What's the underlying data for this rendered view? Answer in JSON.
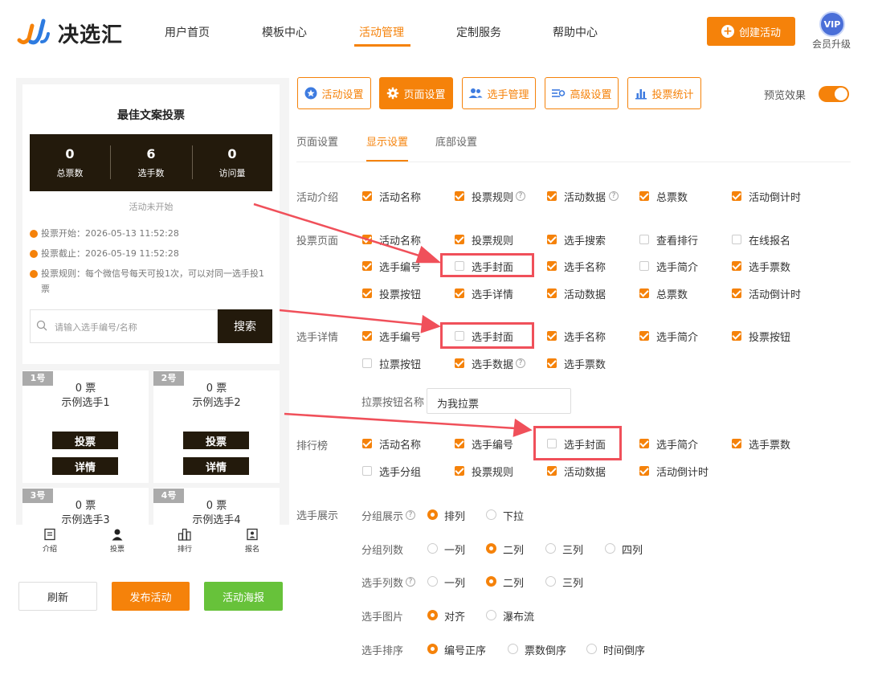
{
  "header": {
    "logo_text": "决选汇",
    "nav": [
      "用户首页",
      "模板中心",
      "活动管理",
      "定制服务",
      "帮助中心"
    ],
    "create_button": "创建活动",
    "vip_badge": "VIP",
    "vip_label": "会员升级",
    "accent_color": "#f5820a"
  },
  "preview": {
    "title": "最佳文案投票",
    "stats": [
      {
        "value": "0",
        "label": "总票数"
      },
      {
        "value": "6",
        "label": "选手数"
      },
      {
        "value": "0",
        "label": "访问量"
      }
    ],
    "status": "活动未开始",
    "info": [
      "投票开始：2026-05-13 11:52:28",
      "投票截止：2026-05-19 11:52:28",
      "投票规则：每个微信号每天可投1次，可以对同一选手投1票"
    ],
    "search_placeholder": "请输入选手编号/名称",
    "search_button": "搜索",
    "candidates": [
      {
        "tag": "1号",
        "votes": "0 票",
        "name": "示例选手1",
        "vote_btn": "投票",
        "detail_btn": "详情"
      },
      {
        "tag": "2号",
        "votes": "0 票",
        "name": "示例选手2",
        "vote_btn": "投票",
        "detail_btn": "详情"
      },
      {
        "tag": "3号",
        "votes": "0 票",
        "name": "示例选手3"
      },
      {
        "tag": "4号",
        "votes": "0 票",
        "name": "示例选手4"
      }
    ],
    "bottom_tabs": [
      "介绍",
      "投票",
      "排行",
      "报名"
    ]
  },
  "actions": {
    "refresh": "刷新",
    "publish": "发布活动",
    "poster": "活动海报"
  },
  "top_buttons": [
    "活动设置",
    "页面设置",
    "选手管理",
    "高级设置",
    "投票统计"
  ],
  "preview_toggle_label": "预览效果",
  "subtabs": [
    "页面设置",
    "显示设置",
    "底部设置"
  ],
  "sections": {
    "intro": {
      "label": "活动介绍",
      "items": [
        {
          "label": "活动名称",
          "checked": true
        },
        {
          "label": "投票规则",
          "checked": true
        },
        {
          "label": "活动数据",
          "checked": true
        },
        {
          "label": "总票数",
          "checked": true
        },
        {
          "label": "活动倒计时",
          "checked": true
        }
      ]
    },
    "vote_page": {
      "label": "投票页面",
      "rows": [
        [
          {
            "label": "活动名称",
            "checked": true
          },
          {
            "label": "投票规则",
            "checked": true
          },
          {
            "label": "选手搜索",
            "checked": true
          },
          {
            "label": "查看排行",
            "checked": false
          },
          {
            "label": "在线报名",
            "checked": false
          }
        ],
        [
          {
            "label": "选手编号",
            "checked": true
          },
          {
            "label": "选手封面",
            "checked": false
          },
          {
            "label": "选手名称",
            "checked": true
          },
          {
            "label": "选手简介",
            "checked": false
          },
          {
            "label": "选手票数",
            "checked": true
          }
        ],
        [
          {
            "label": "投票按钮",
            "checked": true
          },
          {
            "label": "选手详情",
            "checked": true
          },
          {
            "label": "活动数据",
            "checked": true
          },
          {
            "label": "总票数",
            "checked": true
          },
          {
            "label": "活动倒计时",
            "checked": true
          }
        ]
      ]
    },
    "detail": {
      "label": "选手详情",
      "rows": [
        [
          {
            "label": "选手编号",
            "checked": true
          },
          {
            "label": "选手封面",
            "checked": false
          },
          {
            "label": "选手名称",
            "checked": true
          },
          {
            "label": "选手简介",
            "checked": true
          },
          {
            "label": "投票按钮",
            "checked": true
          }
        ],
        [
          {
            "label": "拉票按钮",
            "checked": false
          },
          {
            "label": "选手数据",
            "checked": true
          },
          {
            "label": "选手票数",
            "checked": true
          }
        ]
      ],
      "pull_label": "拉票按钮名称",
      "pull_value": "为我拉票"
    },
    "ranking": {
      "label": "排行榜",
      "rows": [
        [
          {
            "label": "活动名称",
            "checked": true
          },
          {
            "label": "选手编号",
            "checked": true
          },
          {
            "label": "选手封面",
            "checked": false
          },
          {
            "label": "选手简介",
            "checked": true
          },
          {
            "label": "选手票数",
            "checked": true
          }
        ],
        [
          {
            "label": "选手分组",
            "checked": false
          },
          {
            "label": "投票规则",
            "checked": true
          },
          {
            "label": "活动数据",
            "checked": true
          },
          {
            "label": "活动倒计时",
            "checked": true
          }
        ]
      ]
    },
    "display": {
      "label": "选手展示",
      "rows": [
        {
          "label": "分组展示",
          "help": true,
          "options": [
            "排列",
            "下拉"
          ],
          "selected": 0
        },
        {
          "label": "分组列数",
          "help": false,
          "options": [
            "一列",
            "二列",
            "三列",
            "四列"
          ],
          "selected": 1
        },
        {
          "label": "选手列数",
          "help": true,
          "options": [
            "一列",
            "二列",
            "三列"
          ],
          "selected": 1
        },
        {
          "label": "选手图片",
          "help": false,
          "options": [
            "对齐",
            "瀑布流"
          ],
          "selected": 0
        },
        {
          "label": "选手排序",
          "help": false,
          "options": [
            "编号正序",
            "票数倒序",
            "时间倒序"
          ],
          "selected": 0
        }
      ]
    }
  }
}
